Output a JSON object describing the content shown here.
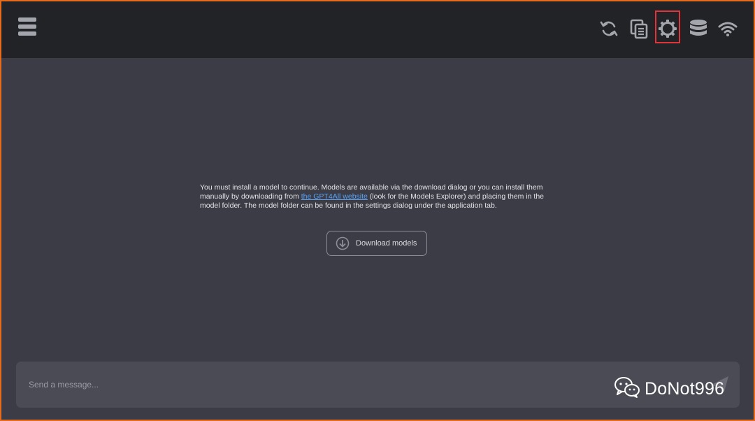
{
  "toolbar": {
    "menu_icon": "hamburger-menu-icon",
    "icons": [
      "refresh-icon",
      "copy-icon",
      "gear-icon",
      "database-icon",
      "wifi-icon"
    ],
    "highlight_color": "#e0353a"
  },
  "main": {
    "message_before_link": "You must install a model to continue. Models are available via the download dialog or you can install them manually by downloading from ",
    "link_text": "the GPT4All website",
    "message_after_link": " (look for the Models Explorer) and placing them in the model folder. The model folder can be found in the settings dialog under the application tab.",
    "download_button_label": "Download models",
    "link_color": "#5ba3f5"
  },
  "input": {
    "placeholder": "Send a message..."
  },
  "watermark": {
    "text": "DoNot996"
  },
  "colors": {
    "frame_border": "#e46c1e",
    "topbar_bg": "#222326",
    "content_bg": "#3b3c45",
    "input_bg": "#4a4b55"
  }
}
